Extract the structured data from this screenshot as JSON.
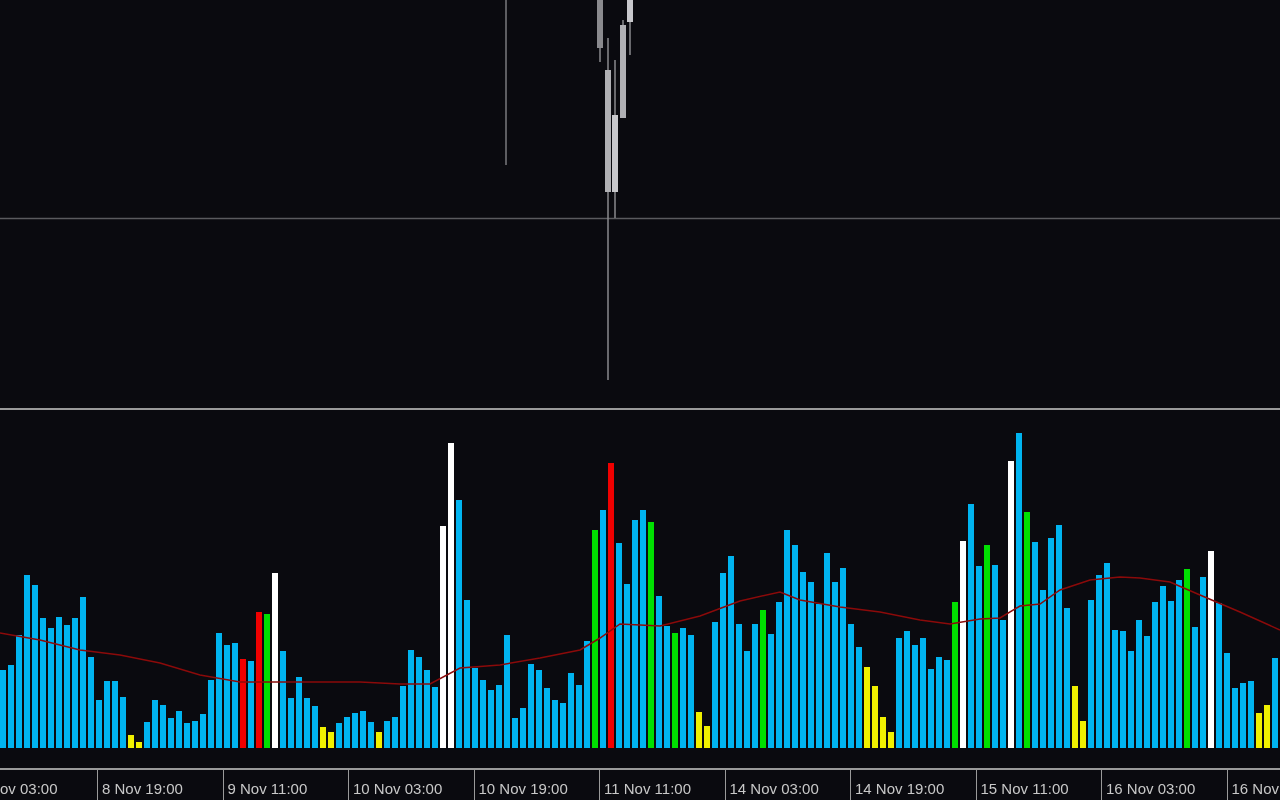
{
  "time_axis": {
    "labels": [
      "ov 03:00",
      "8 Nov 19:00",
      "9 Nov 11:00",
      "10 Nov 03:00",
      "10 Nov 19:00",
      "11 Nov 11:00",
      "14 Nov 03:00",
      "14 Nov 19:00",
      "15 Nov 11:00",
      "16 Nov 03:00",
      "16 Nov"
    ]
  }
}
